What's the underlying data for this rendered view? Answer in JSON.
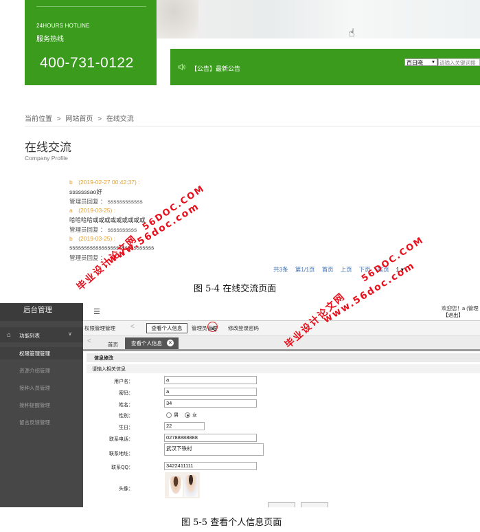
{
  "fig54": {
    "hotline_en": "24HOURS  HOTLINE",
    "hotline_cn": "服务热线",
    "hotline_number": "400-731-0122",
    "notice_label": "【公告】最新公告",
    "search_engine": "百日晓",
    "search_placeholder": "请输入关键词搜",
    "breadcrumb": {
      "current": "当前位置",
      "sep1": ">",
      "home": "网站首页",
      "sep2": ">",
      "page": "在线交流"
    },
    "title": "在线交流",
    "subtitle": "Company Profile",
    "messages": [
      {
        "head": "b　(2019-02-27 00:42:37) :",
        "body": "sssssssao好",
        "reply": "管理员回复 ：  ssssssssssss"
      },
      {
        "head": "a　(2019-03-25) :",
        "body": "哈哈哈哈或或或或或或或或或",
        "reply": "管理员回复 ：  ssssssssss"
      },
      {
        "head": "b　(2019-03-25) :",
        "body": "sssssssssssssssssssssssssssss",
        "reply": "管理员回复 ："
      }
    ],
    "pager": {
      "total": "共3条",
      "page_info": "第1/1页",
      "first": "首页",
      "prev": "上页",
      "next": "下页",
      "last": "尾页",
      "current": "1 ▾"
    },
    "caption": "图 5-4 在线交流页面"
  },
  "fig55": {
    "sidebar_title": "后台管理",
    "func_list": "功能列表",
    "menu": [
      {
        "label": "权限管理管理",
        "active": true
      },
      {
        "label": "资源介绍管理",
        "active": false
      },
      {
        "label": "接种人员管理",
        "active": false
      },
      {
        "label": "接种提醒管理",
        "active": false
      },
      {
        "label": "留言反馈管理",
        "active": false
      }
    ],
    "welcome": "欢迎您！a (管理",
    "logout": "【退出】",
    "tabs": {
      "perm": "权限管理管理",
      "view": "查看个人信息",
      "mgr": "管理员管理",
      "pwd": "修改登录密码"
    },
    "subtabs": {
      "home": "首页",
      "view": "查看个人信息"
    },
    "section_title": "信息修改",
    "section_subtitle": "请输入相关信息",
    "fields": {
      "username_label": "用户名：",
      "username": "a",
      "password_label": "密码：",
      "password": "a",
      "name_label": "姓名：",
      "name": "34",
      "gender_label": "性别：",
      "gender_male": "男",
      "gender_female": "女",
      "gender_selected": "女",
      "birthday_label": "生日：",
      "birthday": "22",
      "phone_label": "联系电话：",
      "phone": "02788888888",
      "address_label": "联系地址：",
      "address": "武汉下铁村",
      "qq_label": "联系QQ：",
      "qq": "3422411111",
      "avatar_label": "头像："
    },
    "caption": "图 5-5 查看个人信息页面"
  },
  "watermarks": {
    "site": "www.56doc.com",
    "site_upper": "56DOC.COM",
    "network": "毕业设计论文网"
  },
  "colors": {
    "green": "#3a9b1d",
    "sidebar": "#474747",
    "watermark": "#e8101c",
    "message_head": "#e0a03a",
    "link": "#3c6fb3"
  }
}
